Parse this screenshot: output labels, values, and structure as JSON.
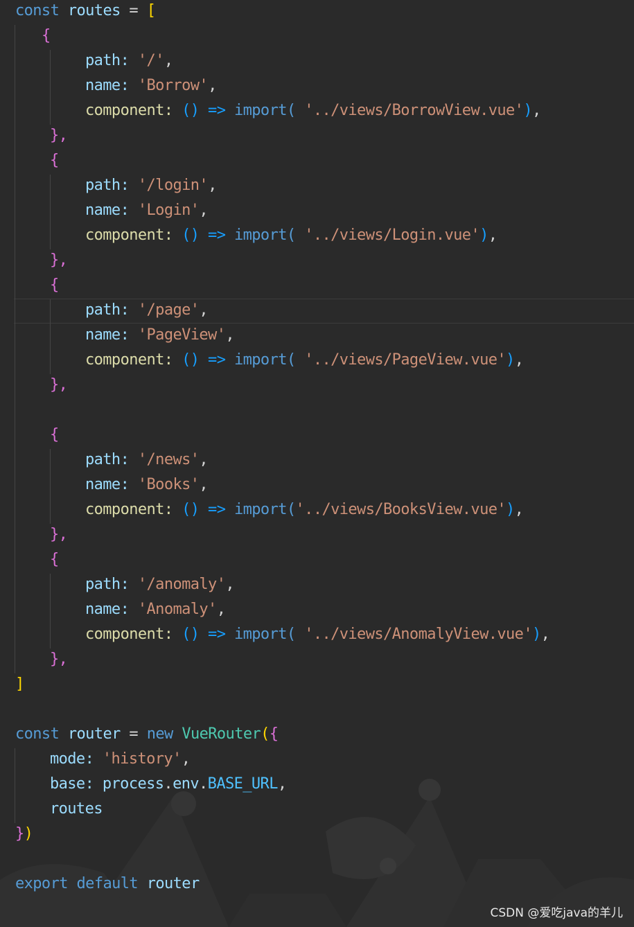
{
  "colors": {
    "background": "#2a2a2a",
    "keyword": "#569cd6",
    "variable": "#9cdcfe",
    "string": "#ce9178",
    "class": "#4ec9b0",
    "bracket_gold": "#ffd700",
    "bracket_violet": "#da70d6",
    "bracket_blue": "#179fff"
  },
  "code": {
    "routes_decl": {
      "kw": "const",
      "name": "routes",
      "op": "=",
      "open": "["
    },
    "routes": [
      {
        "open": "{",
        "path_key": "path:",
        "path_val": "'/'",
        "name_key": "name:",
        "name_val": "'Borrow'",
        "comp_key": "component:",
        "arrow": "() =>",
        "import_kw": "import(",
        "import_path": "'../views/BorrowView.vue'",
        "close": "},"
      },
      {
        "open": "{",
        "path_key": "path:",
        "path_val": "'/login'",
        "name_key": "name:",
        "name_val": "'Login'",
        "comp_key": "component:",
        "arrow": "() =>",
        "import_kw": "import(",
        "import_path": "'../views/Login.vue'",
        "close": "},"
      },
      {
        "open": "{",
        "path_key": "path:",
        "path_val": "'/page'",
        "name_key": "name:",
        "name_val": "'PageView'",
        "comp_key": "component:",
        "arrow": "() =>",
        "import_kw": "import(",
        "import_path": "'../views/PageView.vue'",
        "close": "},"
      },
      {
        "open": "{",
        "path_key": "path:",
        "path_val": "'/news'",
        "name_key": "name:",
        "name_val": "'Books'",
        "comp_key": "component:",
        "arrow": "() =>",
        "import_kw": "import(",
        "import_path": "'../views/BooksView.vue'",
        "close": "},"
      },
      {
        "open": "{",
        "path_key": "path:",
        "path_val": "'/anomaly'",
        "name_key": "name:",
        "name_val": "'Anomaly'",
        "comp_key": "component:",
        "arrow": "() =>",
        "import_kw": "import(",
        "import_path": "'../views/AnomalyView.vue'",
        "close": "},"
      }
    ],
    "routes_close": "]",
    "router_decl": {
      "kw": "const",
      "name": "router",
      "op": "=",
      "new_kw": "new",
      "cls": "VueRouter",
      "open_paren": "(",
      "open_brace": "{"
    },
    "router_mode": {
      "key": "mode:",
      "val": "'history'"
    },
    "router_base": {
      "key": "base:",
      "obj": "process",
      "prop": "env",
      "const": "BASE_URL"
    },
    "router_routes": "routes",
    "router_close": {
      "brace": "}",
      "paren": ")"
    },
    "export_line": {
      "kw1": "export",
      "kw2": "default",
      "name": "router"
    }
  },
  "watermark": "CSDN @爱吃java的羊儿"
}
